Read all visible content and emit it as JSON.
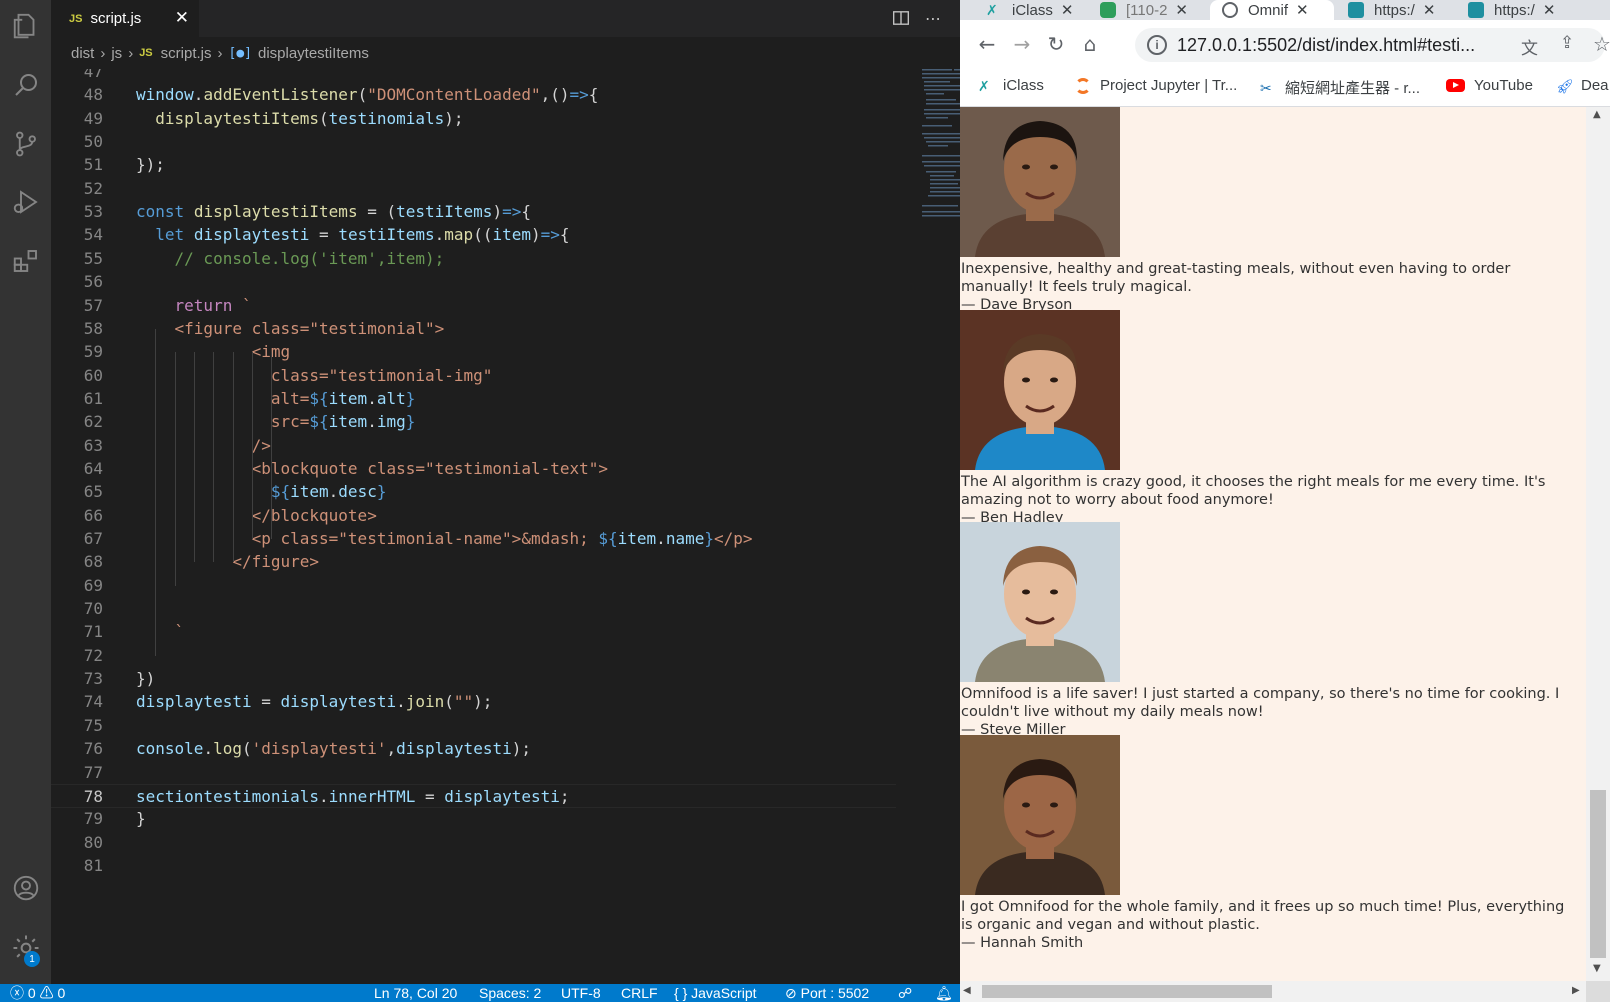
{
  "vscode": {
    "tab": {
      "badge": "JS",
      "filename": "script.js"
    },
    "breadcrumb": {
      "items": [
        "dist",
        "js"
      ],
      "js_badge": "JS",
      "file": "script.js",
      "symbol": "displaytestiItems"
    },
    "status": {
      "errors": "0",
      "warnings": "0",
      "position": "Ln 78, Col 20",
      "spaces": "Spaces: 2",
      "encoding": "UTF-8",
      "eol": "CRLF",
      "language": "JavaScript",
      "port": "Port : 5502",
      "notifications": "1"
    },
    "current_line": 78,
    "code": [
      {
        "n": "47",
        "t": []
      },
      {
        "n": "48",
        "t": [
          [
            "window",
            "t-var"
          ],
          [
            ".",
            "t-pl"
          ],
          [
            "addEventListener",
            "t-fn"
          ],
          [
            "(",
            "t-pl"
          ],
          [
            "\"DOMContentLoaded\"",
            "t-str"
          ],
          [
            ",()",
            "t-pl"
          ],
          [
            "=>",
            "t-kw"
          ],
          [
            "{",
            "t-pl"
          ]
        ]
      },
      {
        "n": "49",
        "t": [
          [
            "  ",
            "t-pl"
          ],
          [
            "displaytestiItems",
            "t-fn"
          ],
          [
            "(",
            "t-pl"
          ],
          [
            "testinomials",
            "t-var"
          ],
          [
            ");",
            "t-pl"
          ]
        ]
      },
      {
        "n": "50",
        "t": []
      },
      {
        "n": "51",
        "t": [
          [
            "});",
            "t-pl"
          ]
        ]
      },
      {
        "n": "52",
        "t": []
      },
      {
        "n": "53",
        "t": [
          [
            "const",
            "t-kw"
          ],
          [
            " ",
            "t-pl"
          ],
          [
            "displaytestiItems",
            "t-fn"
          ],
          [
            " = (",
            "t-pl"
          ],
          [
            "testiItems",
            "t-var"
          ],
          [
            ")",
            "t-pl"
          ],
          [
            "=>",
            "t-kw"
          ],
          [
            "{",
            "t-pl"
          ]
        ]
      },
      {
        "n": "54",
        "t": [
          [
            "  ",
            "t-pl"
          ],
          [
            "let",
            "t-kw"
          ],
          [
            " ",
            "t-pl"
          ],
          [
            "displaytesti",
            "t-var"
          ],
          [
            " = ",
            "t-pl"
          ],
          [
            "testiItems",
            "t-var"
          ],
          [
            ".",
            "t-pl"
          ],
          [
            "map",
            "t-fn"
          ],
          [
            "((",
            "t-pl"
          ],
          [
            "item",
            "t-var"
          ],
          [
            ")",
            "t-pl"
          ],
          [
            "=>",
            "t-kw"
          ],
          [
            "{",
            "t-pl"
          ]
        ]
      },
      {
        "n": "55",
        "t": [
          [
            "    ",
            "t-pl"
          ],
          [
            "// console.log('item',item);",
            "t-cm"
          ]
        ]
      },
      {
        "n": "56",
        "t": []
      },
      {
        "n": "57",
        "t": [
          [
            "    ",
            "t-pl"
          ],
          [
            "return",
            "t-ctl"
          ],
          [
            " `",
            "t-str"
          ]
        ]
      },
      {
        "n": "58",
        "t": [
          [
            "    <figure class=\"testimonial\">",
            "t-str"
          ]
        ]
      },
      {
        "n": "59",
        "t": [
          [
            "            <img",
            "t-str"
          ]
        ]
      },
      {
        "n": "60",
        "t": [
          [
            "              class=\"testimonial-img\"",
            "t-str"
          ]
        ]
      },
      {
        "n": "61",
        "t": [
          [
            "              alt=",
            "t-str"
          ],
          [
            "${",
            "t-kw"
          ],
          [
            "item",
            "t-var"
          ],
          [
            ".",
            "t-pl"
          ],
          [
            "alt",
            "t-var"
          ],
          [
            "}",
            "t-kw"
          ]
        ]
      },
      {
        "n": "62",
        "t": [
          [
            "              src=",
            "t-str"
          ],
          [
            "${",
            "t-kw"
          ],
          [
            "item",
            "t-var"
          ],
          [
            ".",
            "t-pl"
          ],
          [
            "img",
            "t-var"
          ],
          [
            "}",
            "t-kw"
          ]
        ]
      },
      {
        "n": "63",
        "t": [
          [
            "            />",
            "t-str"
          ]
        ]
      },
      {
        "n": "64",
        "t": [
          [
            "            <blockquote class=\"testimonial-text\">",
            "t-str"
          ]
        ]
      },
      {
        "n": "65",
        "t": [
          [
            "              ",
            "t-str"
          ],
          [
            "${",
            "t-kw"
          ],
          [
            "item",
            "t-var"
          ],
          [
            ".",
            "t-pl"
          ],
          [
            "desc",
            "t-var"
          ],
          [
            "}",
            "t-kw"
          ]
        ]
      },
      {
        "n": "66",
        "t": [
          [
            "            </blockquote>",
            "t-str"
          ]
        ]
      },
      {
        "n": "67",
        "t": [
          [
            "            <p class=\"testimonial-name\">&mdash; ",
            "t-str"
          ],
          [
            "${",
            "t-kw"
          ],
          [
            "item",
            "t-var"
          ],
          [
            ".",
            "t-pl"
          ],
          [
            "name",
            "t-var"
          ],
          [
            "}",
            "t-kw"
          ],
          [
            "</p>",
            "t-str"
          ]
        ]
      },
      {
        "n": "68",
        "t": [
          [
            "          </figure>",
            "t-str"
          ]
        ]
      },
      {
        "n": "69",
        "t": []
      },
      {
        "n": "70",
        "t": []
      },
      {
        "n": "71",
        "t": [
          [
            "    `",
            "t-str"
          ]
        ]
      },
      {
        "n": "72",
        "t": []
      },
      {
        "n": "73",
        "t": [
          [
            "})",
            "t-pl"
          ]
        ]
      },
      {
        "n": "74",
        "t": [
          [
            "displaytesti",
            "t-var"
          ],
          [
            " = ",
            "t-pl"
          ],
          [
            "displaytesti",
            "t-var"
          ],
          [
            ".",
            "t-pl"
          ],
          [
            "join",
            "t-fn"
          ],
          [
            "(",
            "t-pl"
          ],
          [
            "\"\"",
            "t-str"
          ],
          [
            ");",
            "t-pl"
          ]
        ]
      },
      {
        "n": "75",
        "t": []
      },
      {
        "n": "76",
        "t": [
          [
            "console",
            "t-var"
          ],
          [
            ".",
            "t-pl"
          ],
          [
            "log",
            "t-fn"
          ],
          [
            "(",
            "t-pl"
          ],
          [
            "'displaytesti'",
            "t-str"
          ],
          [
            ",",
            "t-pl"
          ],
          [
            "displaytesti",
            "t-var"
          ],
          [
            ");",
            "t-pl"
          ]
        ]
      },
      {
        "n": "77",
        "t": []
      },
      {
        "n": "78",
        "t": [
          [
            "sectiontestimonials",
            "t-var"
          ],
          [
            ".",
            "t-pl"
          ],
          [
            "innerHTML",
            "t-var"
          ],
          [
            " = ",
            "t-pl"
          ],
          [
            "displaytesti",
            "t-var"
          ],
          [
            ";",
            "t-pl"
          ]
        ]
      },
      {
        "n": "79",
        "t": [
          [
            "}",
            "t-pl"
          ]
        ]
      },
      {
        "n": "80",
        "t": []
      },
      {
        "n": "81",
        "t": []
      }
    ]
  },
  "browser": {
    "tabs": [
      {
        "label": "iClass",
        "active": false
      },
      {
        "label": "[110-2",
        "active": false
      },
      {
        "label": "Omnif",
        "active": true
      },
      {
        "label": "https:/",
        "active": false
      },
      {
        "label": "https:/",
        "active": false
      }
    ],
    "url": "127.0.0.1:5502/dist/index.html#testi...",
    "bookmarks": [
      "iClass",
      "Project Jupyter | Tr...",
      "縮短網址產生器 - r...",
      "YouTube",
      "Dea"
    ],
    "testimonials": [
      {
        "text": "Inexpensive, healthy and great-tasting meals, without even having to order manually! It feels truly magical.",
        "name": "— Dave Bryson",
        "skin": "#9a6a4a",
        "hair": "#1c1410",
        "bg": "#6e5a4c",
        "shirt": "#5a4032"
      },
      {
        "text": "The AI algorithm is crazy good, it chooses the right meals for me every time. It's amazing not to worry about food anymore!",
        "name": "— Ben Hadley",
        "skin": "#d8a886",
        "hair": "#5a3a26",
        "bg": "#5b3324",
        "shirt": "#1e88c8"
      },
      {
        "text": "Omnifood is a life saver! I just started a company, so there's no time for cooking. I couldn't live without my daily meals now!",
        "name": "— Steve Miller",
        "skin": "#e6bc9c",
        "hair": "#8a6040",
        "bg": "#c8d4dc",
        "shirt": "#8a8470"
      },
      {
        "text": "I got Omnifood for the whole family, and it frees up so much time! Plus, everything is organic and vegan and without plastic.",
        "name": "— Hannah Smith",
        "skin": "#9c6646",
        "hair": "#2a1a12",
        "bg": "#7a5a3c",
        "shirt": "#3a2a20"
      }
    ]
  }
}
